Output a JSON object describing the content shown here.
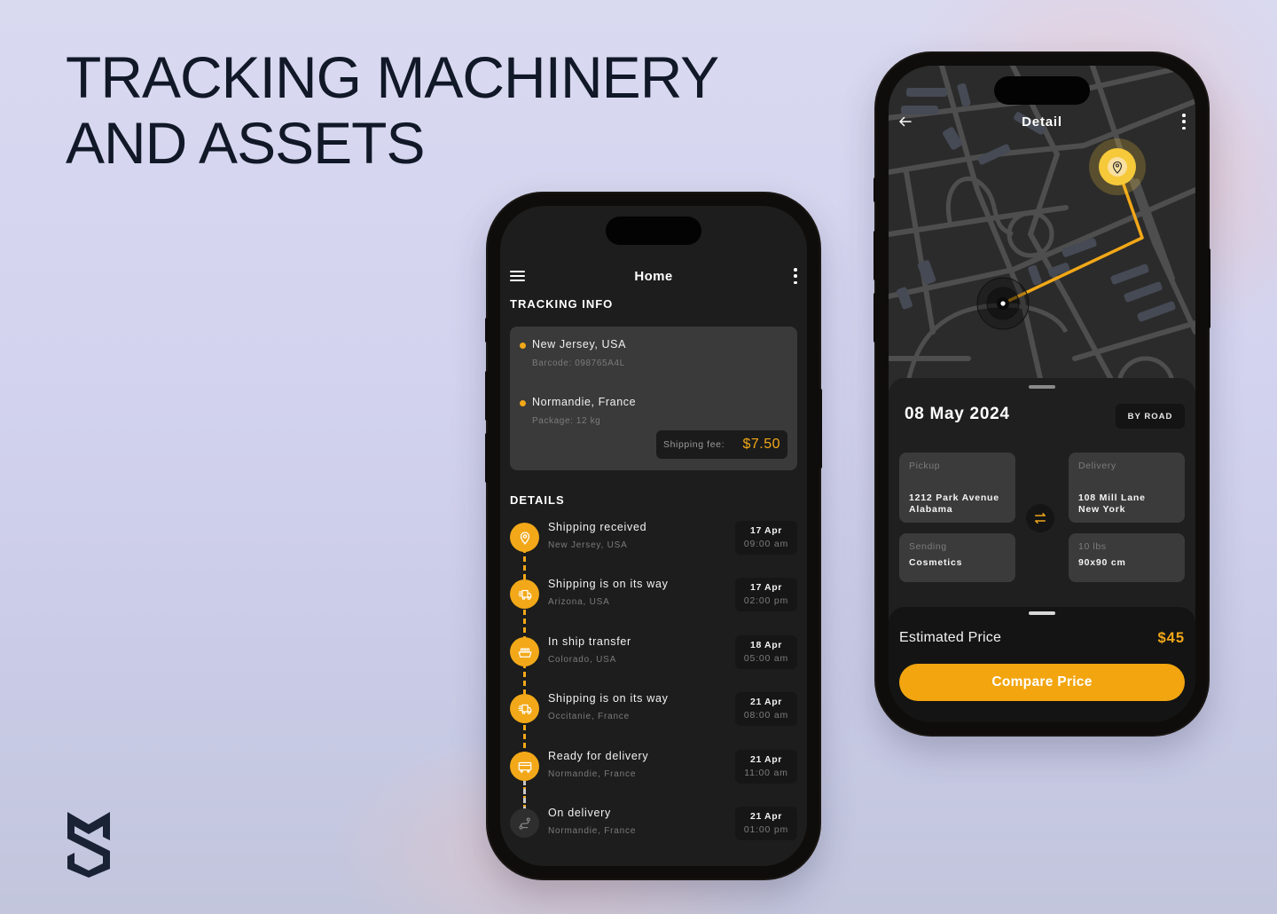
{
  "headline": {
    "line1": "TRACKING MACHINERY",
    "line2": "AND ASSETS"
  },
  "brand": {
    "logo_icon": "shield-s-logo-icon"
  },
  "colors": {
    "accent": "#f2a818",
    "screen_bg": "#1c1d1c",
    "card_bg": "#3a3a3a",
    "map_bg": "#2a2a2a",
    "headline": "#111827"
  },
  "home": {
    "header": {
      "title": "Home",
      "menu_icon": "hamburger-icon",
      "more_icon": "kebab-icon"
    },
    "tracking_info": {
      "title": "TRACKING INFO",
      "origin": {
        "name": "New Jersey, USA",
        "sub": "Barcode: 098765A4L"
      },
      "destination": {
        "name": "Normandie, France",
        "sub": "Package: 12 kg"
      },
      "shipping_fee": {
        "label": "Shipping fee:",
        "value": "$7.50"
      }
    },
    "details": {
      "title": "DETAILS",
      "items": [
        {
          "title": "Shipping received",
          "location": "New Jersey, USA",
          "date": "17 Apr",
          "time": "09:00 am",
          "icon": "location-pin-icon",
          "done": true
        },
        {
          "title": "Shipping is on its way",
          "location": "Arizona, USA",
          "date": "17 Apr",
          "time": "02:00 pm",
          "icon": "truck-icon",
          "done": true
        },
        {
          "title": "In ship transfer",
          "location": "Colorado, USA",
          "date": "18 Apr",
          "time": "05:00 am",
          "icon": "ship-icon",
          "done": true
        },
        {
          "title": "Shipping is on its way",
          "location": "Occitanie, France",
          "date": "21 Apr",
          "time": "08:00 am",
          "icon": "truck-icon",
          "done": true
        },
        {
          "title": "Ready for delivery",
          "location": "Normandie, France",
          "date": "21 Apr",
          "time": "11:00 am",
          "icon": "container-icon",
          "done": true
        },
        {
          "title": "On delivery",
          "location": "Normandie, France",
          "date": "21 Apr",
          "time": "01:00 pm",
          "icon": "route-icon",
          "done": false
        }
      ]
    }
  },
  "detail": {
    "header": {
      "title": "Detail",
      "back_icon": "arrow-left-icon",
      "more_icon": "kebab-icon"
    },
    "date": "08 May 2024",
    "mode": "BY ROAD",
    "pickup": {
      "label": "Pickup",
      "line1": "1212 Park Avenue",
      "line2": "Alabama"
    },
    "delivery": {
      "label": "Delivery",
      "line1": "108 Mill Lane",
      "line2": "New York"
    },
    "sending": {
      "label": "Sending",
      "value": "Cosmetics"
    },
    "weight": {
      "label": "10 lbs",
      "value": "90x90 cm"
    },
    "estimated_price": {
      "label": "Estimated Price",
      "value": "$45"
    },
    "compare_button": "Compare Price"
  }
}
